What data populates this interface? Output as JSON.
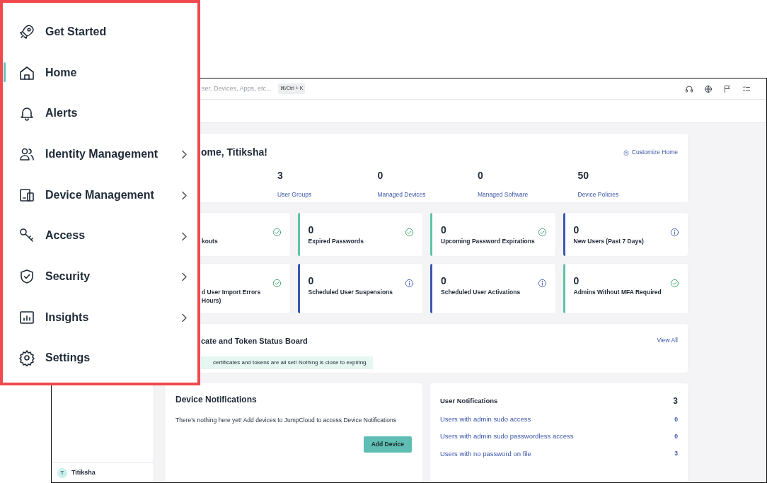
{
  "menu": [
    {
      "label": "Get Started",
      "has_submenu": false,
      "selected": false
    },
    {
      "label": "Home",
      "has_submenu": false,
      "selected": true
    },
    {
      "label": "Alerts",
      "has_submenu": false,
      "selected": false
    },
    {
      "label": "Identity Management",
      "has_submenu": true,
      "selected": false
    },
    {
      "label": "Device Management",
      "has_submenu": true,
      "selected": false
    },
    {
      "label": "Access",
      "has_submenu": true,
      "selected": false
    },
    {
      "label": "Security",
      "has_submenu": true,
      "selected": false
    },
    {
      "label": "Insights",
      "has_submenu": true,
      "selected": false
    },
    {
      "label": "Settings",
      "has_submenu": false,
      "selected": false
    }
  ],
  "topbar": {
    "search": {
      "placeholder": "ser, Devices, Apps, etc..."
    },
    "shortcut": "⌘/Ctrl + K"
  },
  "welcome": {
    "title": "ome, Titiksha!",
    "customize": "Customize Home",
    "stats": [
      {
        "value": "3",
        "label": "User Groups"
      },
      {
        "value": "0",
        "label": "Managed Devices"
      },
      {
        "value": "0",
        "label": "Managed Software"
      },
      {
        "value": "50",
        "label": "Device Policies"
      }
    ]
  },
  "tiles": [
    {
      "label_lines": [
        "kouts"
      ],
      "kind": "ok"
    },
    {
      "value": "0",
      "label_lines": [
        "Expired Passwords"
      ],
      "kind": "ok"
    },
    {
      "value": "0",
      "label_lines": [
        "Upcoming Password Expirations"
      ],
      "kind": "ok"
    },
    {
      "value": "0",
      "label_lines": [
        "New Users (Past 7 Days)"
      ],
      "kind": "info"
    },
    {
      "label_lines": [
        "d User Import Errors",
        "Hours)"
      ],
      "kind": "ok"
    },
    {
      "value": "0",
      "label_lines": [
        "Scheduled User Suspensions"
      ],
      "kind": "info"
    },
    {
      "value": "0",
      "label_lines": [
        "Scheduled User Activations"
      ],
      "kind": "info"
    },
    {
      "value": "0",
      "label_lines": [
        "Admins Without MFA Required"
      ],
      "kind": "ok"
    }
  ],
  "status_board": {
    "title": "cate and Token Status Board",
    "link": "View All",
    "message": "certificates and tokens are all set! Nothing is close to expiring."
  },
  "device_notifications": {
    "title": "Device Notifications",
    "message": "There's nothing here yet! Add devices to JumpCloud to access Device Notifications",
    "button": "Add Device"
  },
  "user_notifications": {
    "title": "User Notifications",
    "count": "3",
    "rows": [
      {
        "label": "Users with admin sudo access",
        "count": "0"
      },
      {
        "label": "Users with admin sudo passwordless access",
        "count": "0"
      },
      {
        "label": "Users with no password on file",
        "count": "3"
      }
    ]
  },
  "user": {
    "initial": "T",
    "name": "Titiksha"
  }
}
